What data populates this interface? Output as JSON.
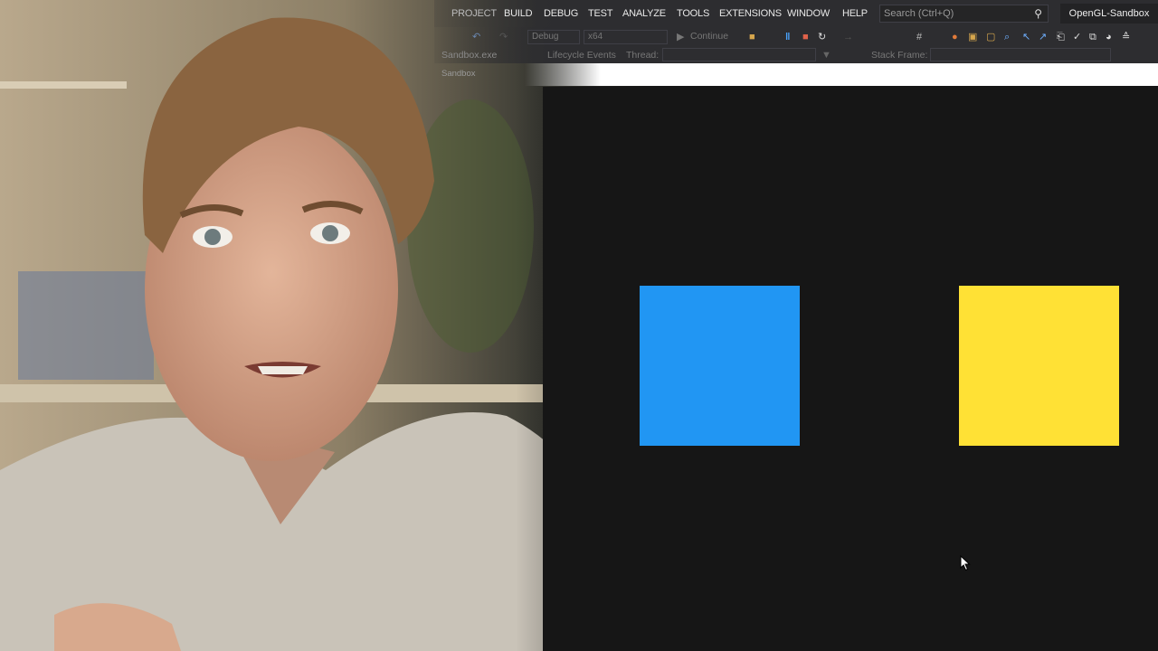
{
  "menu": [
    "PROJECT",
    "BUILD",
    "DEBUG",
    "TEST",
    "ANALYZE",
    "TOOLS",
    "EXTENSIONS",
    "WINDOW",
    "HELP"
  ],
  "search": {
    "placeholder": "Search (Ctrl+Q)"
  },
  "project_title": "OpenGL-Sandbox",
  "toolbar": {
    "configuration": "Debug",
    "platform": "x64",
    "continue_label": "Continue"
  },
  "debug_location": {
    "process": "Sandbox.exe",
    "lifecycle": "Lifecycle Events",
    "thread_label": "Thread:",
    "stack_frame_label": "Stack Frame:"
  },
  "window_title": "Sandbox",
  "scene": {
    "left_square_color": "#2196f3",
    "right_square_color": "#ffe135",
    "background": "#161616"
  }
}
